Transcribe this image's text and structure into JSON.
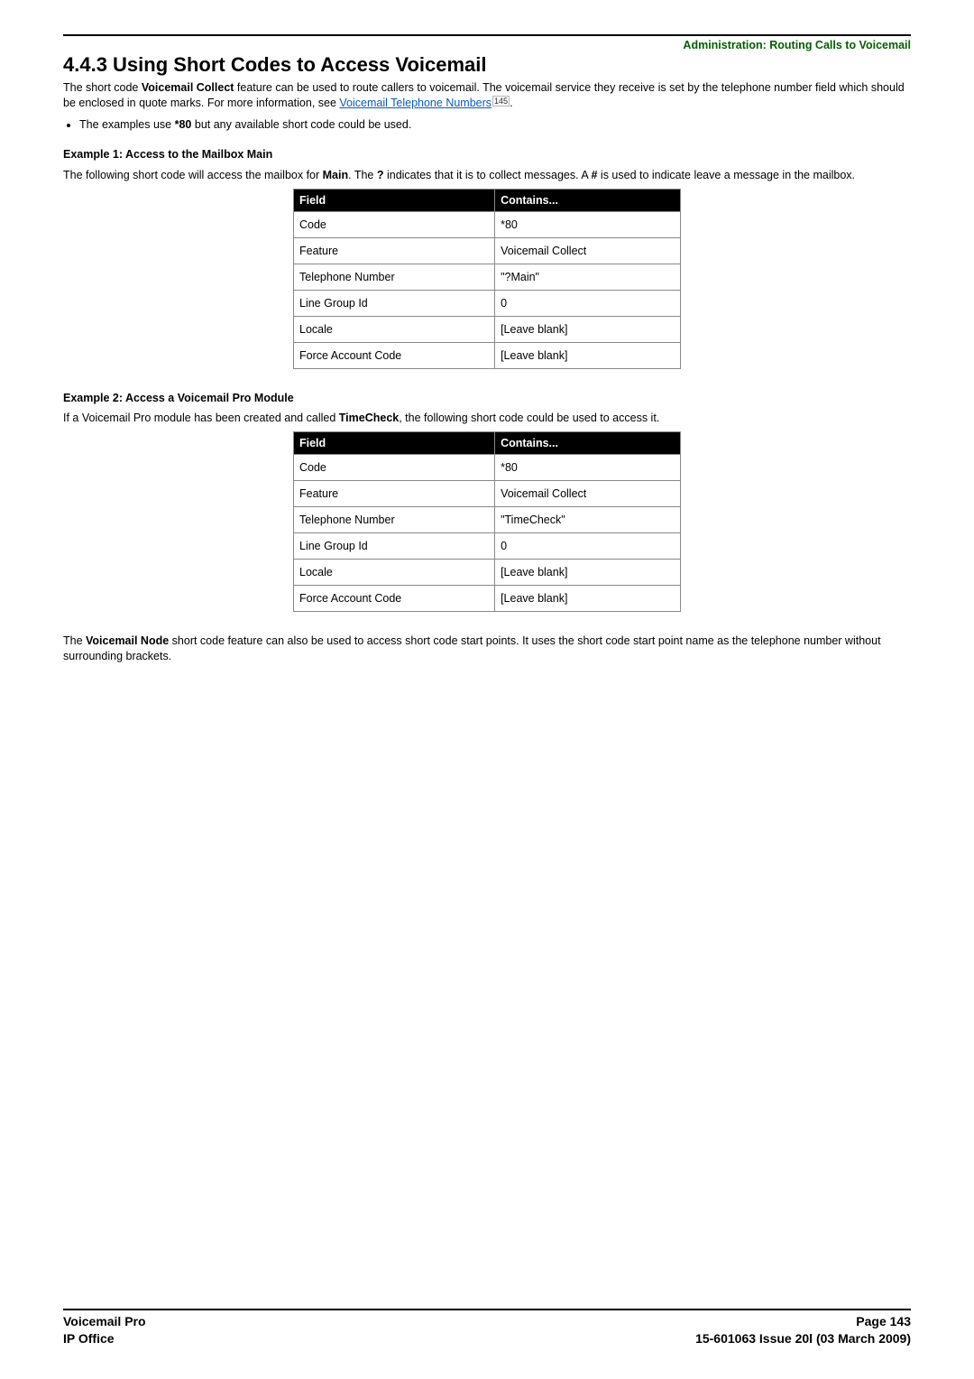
{
  "header": {
    "breadcrumb": "Administration: Routing Calls to Voicemail"
  },
  "title": "4.4.3 Using Short Codes to Access Voicemail",
  "intro": {
    "p1_a": "The short code ",
    "p1_bold1": "Voicemail Collect",
    "p1_b": " feature can be used to route callers to voicemail. The voicemail service they receive is set by the telephone number field which should be enclosed in quote marks. For more information, see ",
    "p1_link": "Voicemail Telephone Numbers",
    "p1_ref": "145",
    "p1_c": "."
  },
  "bullet": {
    "a": "The examples use ",
    "bold": "*80",
    "b": " but any available short code could be used."
  },
  "example1": {
    "title": "Example 1: Access to the Mailbox Main",
    "desc_a": "The following short code will access the mailbox for ",
    "desc_bold1": "Main",
    "desc_b": ". The ",
    "desc_bold2": "?",
    "desc_c": " indicates that it is to collect messages. A ",
    "desc_bold3": "#",
    "desc_d": " is used to indicate leave a message in the mailbox.",
    "headers": {
      "field": "Field",
      "contains": "Contains..."
    },
    "rows": [
      {
        "field": "Code",
        "contains": "*80"
      },
      {
        "field": "Feature",
        "contains": "Voicemail Collect"
      },
      {
        "field": "Telephone Number",
        "contains": "\"?Main\""
      },
      {
        "field": "Line Group Id",
        "contains": "0"
      },
      {
        "field": "Locale",
        "contains": "[Leave blank]"
      },
      {
        "field": "Force Account Code",
        "contains": "[Leave blank]"
      }
    ]
  },
  "example2": {
    "title": "Example 2: Access a Voicemail Pro Module",
    "desc_a": "If a Voicemail Pro module has been created and called ",
    "desc_bold1": "TimeCheck",
    "desc_b": ", the following short code could be used to access it.",
    "headers": {
      "field": "Field",
      "contains": "Contains..."
    },
    "rows": [
      {
        "field": "Code",
        "contains": "*80"
      },
      {
        "field": "Feature",
        "contains": "Voicemail Collect"
      },
      {
        "field": "Telephone Number",
        "contains": "\"TimeCheck\""
      },
      {
        "field": "Line Group Id",
        "contains": "0"
      },
      {
        "field": "Locale",
        "contains": "[Leave blank]"
      },
      {
        "field": "Force Account Code",
        "contains": "[Leave blank]"
      }
    ]
  },
  "closing": {
    "a": "The ",
    "bold": "Voicemail Node",
    "b": " short code feature can also be used to access short code start points. It uses the short code start point name as the telephone number without surrounding brackets."
  },
  "footer": {
    "left1": "Voicemail Pro",
    "left2": "IP Office",
    "right1": "Page 143",
    "right2": "15-601063 Issue 20l (03 March 2009)"
  }
}
